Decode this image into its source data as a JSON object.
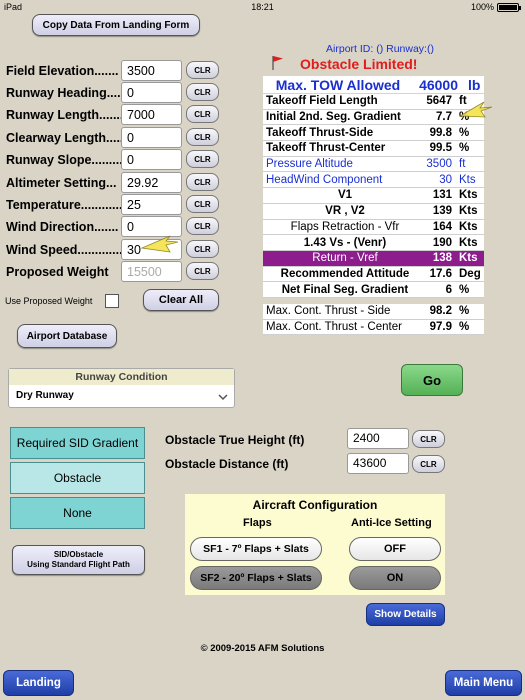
{
  "status_bar": {
    "device": "iPad",
    "time": "18:21",
    "battery": "100%"
  },
  "top_button": "Copy Data From Landing Form",
  "inputs": [
    {
      "label": "Field Elevation.......",
      "value": "3500",
      "placeholder": ""
    },
    {
      "label": "Runway Heading......",
      "value": "0",
      "placeholder": ""
    },
    {
      "label": "Runway Length........",
      "value": "7000",
      "placeholder": ""
    },
    {
      "label": "Clearway Length.....",
      "value": "0",
      "placeholder": ""
    },
    {
      "label": "Runway Slope..........",
      "value": "0",
      "placeholder": ""
    },
    {
      "label": "Altimeter Setting...",
      "value": "29.92",
      "placeholder": ""
    },
    {
      "label": "Temperature............",
      "value": "25",
      "placeholder": ""
    },
    {
      "label": "Wind Direction.......",
      "value": "0",
      "placeholder": ""
    },
    {
      "label": "Wind Speed.............",
      "value": "30",
      "placeholder": ""
    },
    {
      "label": "Proposed Weight",
      "value": "",
      "placeholder": "15500"
    }
  ],
  "clr_label": "CLR",
  "use_proposed_weight_label": "Use Proposed Weight",
  "clear_all_label": "Clear All",
  "airport_database_label": "Airport Database",
  "runway_condition": {
    "title": "Runway Condition",
    "selected": "Dry Runway"
  },
  "header": {
    "airport_line": "Airport ID: () Runway:()",
    "limit_text": "Obstacle Limited!",
    "max_tow_label": "Max. TOW Allowed",
    "max_tow_value": "46000",
    "max_tow_unit": "lb"
  },
  "results": [
    {
      "label": "Takeoff Field Length",
      "value": "5647",
      "unit": "ft"
    },
    {
      "label": "Initial 2nd. Seg. Gradient",
      "value": "7.7",
      "unit": "%"
    },
    {
      "label": "Takeoff Thrust-Side",
      "value": "99.8",
      "unit": "%"
    },
    {
      "label": "Takeoff Thrust-Center",
      "value": "99.5",
      "unit": "%"
    },
    {
      "label": "Pressure Altitude",
      "value": "3500",
      "unit": "ft"
    },
    {
      "label": "HeadWind Component",
      "value": "30",
      "unit": "Kts"
    },
    {
      "label": "V1",
      "value": "131",
      "unit": "Kts"
    },
    {
      "label": "VR , V2",
      "value": "139",
      "unit": "Kts"
    },
    {
      "label": "Flaps Retraction - Vfr",
      "value": "164",
      "unit": "Kts"
    },
    {
      "label": "1.43 Vs - (Venr)",
      "value": "190",
      "unit": "Kts"
    },
    {
      "label": "Return - Vref",
      "value": "138",
      "unit": "Kts"
    },
    {
      "label": "Recommended Attitude",
      "value": "17.6",
      "unit": "Deg"
    },
    {
      "label": "Net Final Seg. Gradient",
      "value": "6",
      "unit": "%"
    },
    {
      "label": "Max. Cont. Thrust - Side",
      "value": "98.2",
      "unit": "%"
    },
    {
      "label": "Max. Cont. Thrust - Center",
      "value": "97.9",
      "unit": "%"
    }
  ],
  "go_label": "Go",
  "gradient_options": [
    "Required SID Gradient",
    "Obstacle",
    "None"
  ],
  "obstacle": {
    "height_label": "Obstacle True Height (ft)",
    "height_value": "2400",
    "distance_label": "Obstacle Distance (ft)",
    "distance_value": "43600"
  },
  "sid_obstacle_label_1": "SID/Obstacle",
  "sid_obstacle_label_2": "Using Standard Flight Path",
  "aircraft_config": {
    "title": "Aircraft Configuration",
    "flaps_header": "Flaps",
    "ice_header": "Anti-Ice Setting",
    "flap1": "SF1 - 7º Flaps + Slats",
    "flap2": "SF2 - 20º Flaps + Slats",
    "ice_off": "OFF",
    "ice_on": "ON"
  },
  "show_details_label": "Show Details",
  "copyright": "© 2009-2015 AFM Solutions",
  "landing_label": "Landing",
  "main_menu_label": "Main Menu",
  "colors": {
    "background": "#d9d4c6",
    "limit_red": "#e21b1b",
    "header_blue": "#1a2fd0",
    "highlight_purple": "#8d1c8d",
    "go_green": "#6fc56f",
    "config_yellow": "#fdfbd0"
  }
}
